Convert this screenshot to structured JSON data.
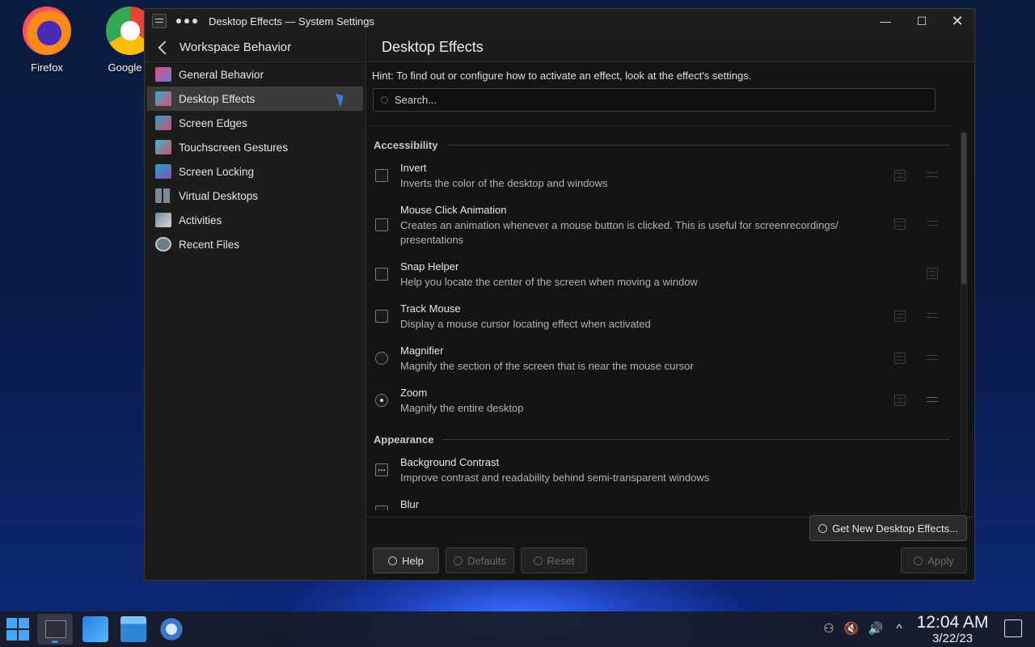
{
  "desktop": {
    "icons": [
      {
        "label": "Firefox"
      },
      {
        "label": "Google C"
      }
    ]
  },
  "window": {
    "title": "Desktop Effects — System Settings",
    "controls": {
      "minimize": "—",
      "maximize": "☐",
      "close": "✕"
    }
  },
  "sidebar": {
    "title": "Workspace Behavior",
    "items": [
      {
        "label": "General Behavior",
        "icon": "general-behavior-icon"
      },
      {
        "label": "Desktop Effects",
        "icon": "desktop-effects-icon",
        "active": true
      },
      {
        "label": "Screen Edges",
        "icon": "screen-edges-icon"
      },
      {
        "label": "Touchscreen Gestures",
        "icon": "touchscreen-gestures-icon"
      },
      {
        "label": "Screen Locking",
        "icon": "screen-locking-icon"
      },
      {
        "label": "Virtual Desktops",
        "icon": "virtual-desktops-icon"
      },
      {
        "label": "Activities",
        "icon": "activities-icon"
      },
      {
        "label": "Recent Files",
        "icon": "recent-files-icon"
      }
    ]
  },
  "main": {
    "title": "Desktop Effects",
    "hint": "Hint: To find out or configure how to activate an effect, look at the effect's settings.",
    "search": {
      "placeholder": "Search...",
      "value": ""
    },
    "sections": [
      {
        "title": "Accessibility",
        "effects": [
          {
            "name": "Invert",
            "desc": "Inverts the color of the desktop and windows",
            "control": "checkbox",
            "checked": false
          },
          {
            "name": "Mouse Click Animation",
            "desc": "Creates an animation whenever a mouse button is clicked. This is useful for screenrecordings/ presentations",
            "control": "checkbox",
            "checked": false
          },
          {
            "name": "Snap Helper",
            "desc": "Help you locate the center of the screen when moving a window",
            "control": "checkbox",
            "checked": false
          },
          {
            "name": "Track Mouse",
            "desc": "Display a mouse cursor locating effect when activated",
            "control": "checkbox",
            "checked": false
          },
          {
            "name": "Magnifier",
            "desc": "Magnify the section of the screen that is near the mouse cursor",
            "control": "radio",
            "checked": false
          },
          {
            "name": "Zoom",
            "desc": "Magnify the entire desktop",
            "control": "radio",
            "checked": true
          }
        ]
      },
      {
        "title": "Appearance",
        "effects": [
          {
            "name": "Background Contrast",
            "desc": "Improve contrast and readability behind semi-transparent windows",
            "control": "partial"
          },
          {
            "name": "Blur",
            "desc": "",
            "control": "partial"
          }
        ]
      }
    ],
    "buttons": {
      "get_new": "Get New Desktop Effects...",
      "help": "Help",
      "defaults": "Defaults",
      "reset": "Reset",
      "apply": "Apply"
    }
  },
  "taskbar": {
    "clock_time": "12:04 AM",
    "clock_date": "3/22/23",
    "tray": {
      "expand": "^"
    }
  }
}
